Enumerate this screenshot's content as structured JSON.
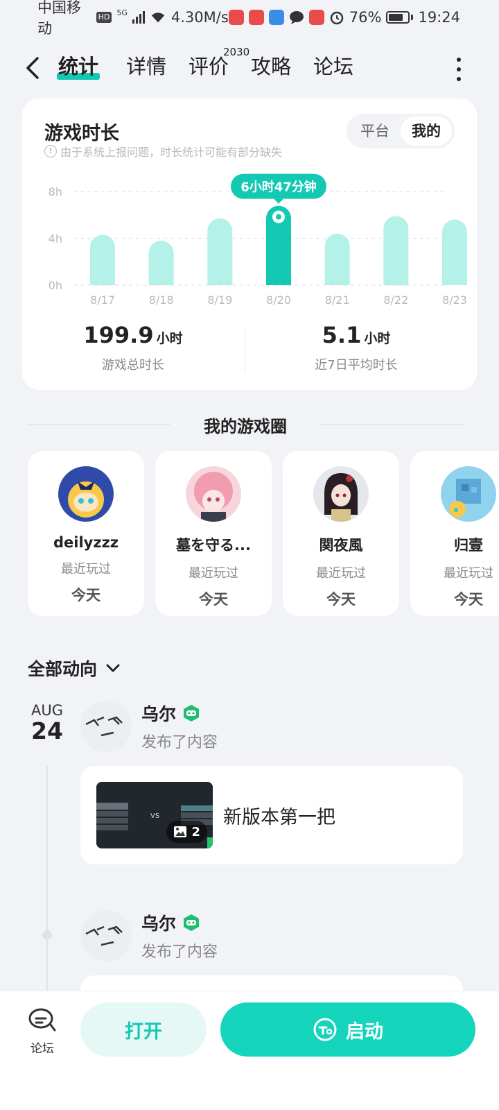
{
  "status_bar": {
    "carrier": "中国移动",
    "hd": "HD",
    "network": "5G",
    "speed": "4.30M/s",
    "battery": "76%",
    "time": "19:24",
    "colors": {
      "app_red": "#e94a4a",
      "app_blue": "#3a8ee8"
    }
  },
  "nav": {
    "tabs": [
      {
        "label": "统计",
        "active": true
      },
      {
        "label": "详情",
        "active": false
      },
      {
        "label": "评价",
        "active": false
      },
      {
        "label": "攻略",
        "active": false
      },
      {
        "label": "论坛",
        "active": false
      }
    ],
    "review_count": "2030",
    "accent_color": "#14c9b4"
  },
  "stats": {
    "title": "游戏时长",
    "note": "由于系统上报问题，时长统计可能有部分缺失",
    "toggle": {
      "options": [
        "平台",
        "我的"
      ],
      "selected": "我的"
    },
    "total": {
      "value": "199.9",
      "unit": "小时",
      "label": "游戏总时长"
    },
    "average": {
      "value": "5.1",
      "unit": "小时",
      "label": "近7日平均时长"
    }
  },
  "chart_data": {
    "type": "bar",
    "categories": [
      "8/17",
      "8/18",
      "8/19",
      "8/20",
      "8/21",
      "8/22",
      "8/23"
    ],
    "values": [
      4.3,
      3.8,
      5.7,
      6.78,
      4.4,
      5.9,
      5.6
    ],
    "unit": "h",
    "yticks": [
      "0h",
      "4h",
      "8h"
    ],
    "ylim": [
      0,
      8
    ],
    "highlight_index": 3,
    "highlight_label": "6小时47分钟",
    "grid": true,
    "bar_color": "#b4f1e8",
    "highlight_color": "#14c9b4"
  },
  "circle": {
    "title": "我的游戏圈",
    "friends": [
      {
        "name": "deilyzzz",
        "sub": "最近玩过",
        "day": "今天"
      },
      {
        "name": "墓を守る...",
        "sub": "最近玩过",
        "day": "今天"
      },
      {
        "name": "関夜風",
        "sub": "最近玩过",
        "day": "今天"
      },
      {
        "name": "归壹",
        "sub": "最近玩过",
        "day": "今天"
      }
    ]
  },
  "activity": {
    "filter": "全部动向",
    "date": {
      "month": "AUG",
      "day": "24"
    },
    "posts": [
      {
        "user": "乌尔",
        "action": "发布了内容",
        "text": "新版本第一把",
        "image_count": "2"
      },
      {
        "user": "乌尔",
        "action": "发布了内容"
      }
    ]
  },
  "bottom": {
    "forum": "论坛",
    "open": "打开",
    "launch": "启动"
  }
}
